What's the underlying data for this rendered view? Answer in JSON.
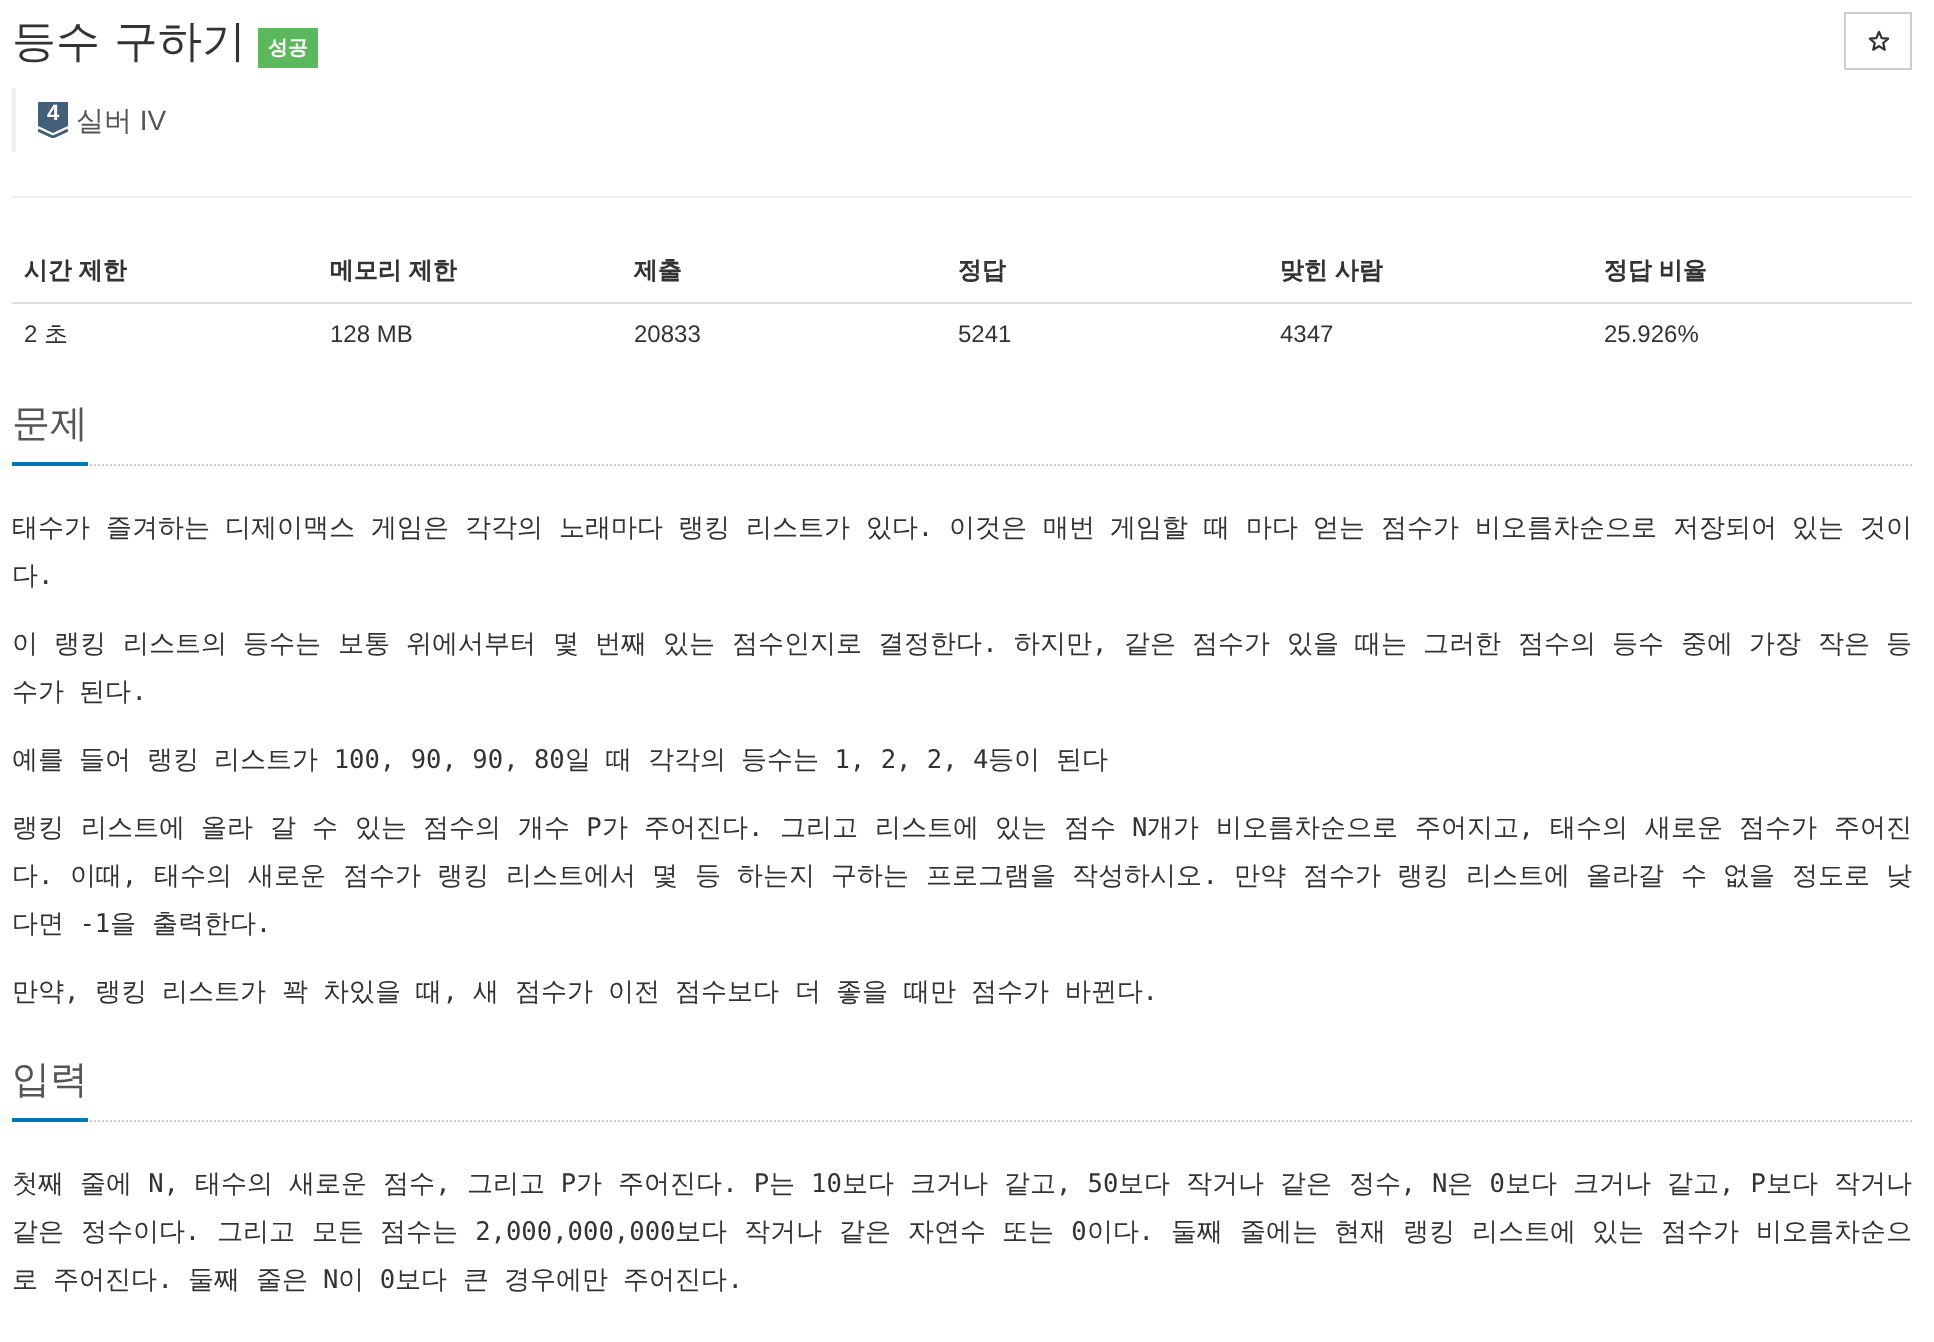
{
  "problem": {
    "title": "등수 구하기",
    "result_badge": {
      "label": "성공",
      "kind": "success"
    }
  },
  "tier": {
    "number": "4",
    "label": "실버 IV",
    "kind": "silver"
  },
  "stats": {
    "columns": [
      "시간 제한",
      "메모리 제한",
      "제출",
      "정답",
      "맞힌 사람",
      "정답 비율"
    ],
    "rows": [
      [
        "2 초",
        "128 MB",
        "20833",
        "5241",
        "4347",
        "25.926%"
      ]
    ]
  },
  "sections": [
    {
      "heading": "문제",
      "paragraphs": [
        "태수가 즐겨하는 디제이맥스 게임은 각각의 노래마다 랭킹 리스트가 있다. 이것은 매번 게임할 때 마다 얻는 점수가 비오름차순으로 저장되어 있는 것이다.",
        "이 랭킹 리스트의 등수는 보통 위에서부터 몇 번째 있는 점수인지로 결정한다. 하지만, 같은 점수가 있을 때는 그러한 점수의 등수 중에 가장 작은 등수가 된다.",
        "예를 들어 랭킹 리스트가 100, 90, 90, 80일 때 각각의 등수는 1, 2, 2, 4등이 된다",
        "랭킹 리스트에 올라 갈 수 있는 점수의 개수 P가 주어진다. 그리고 리스트에 있는 점수 N개가 비오름차순으로 주어지고, 태수의 새로운 점수가 주어진다. 이때, 태수의 새로운 점수가 랭킹 리스트에서 몇 등 하는지 구하는 프로그램을 작성하시오. 만약 점수가 랭킹 리스트에 올라갈 수 없을 정도로 낮다면 -1을 출력한다.",
        "만약, 랭킹 리스트가 꽉 차있을 때, 새 점수가 이전 점수보다 더 좋을 때만 점수가 바뀐다."
      ]
    },
    {
      "heading": "입력",
      "paragraphs": [
        "첫째 줄에 N, 태수의 새로운 점수, 그리고 P가 주어진다. P는 10보다 크거나 같고, 50보다 작거나 같은 정수, N은 0보다 크거나 같고, P보다 작거나 같은 정수이다. 그리고 모든 점수는 2,000,000,000보다 작거나 같은 자연수 또는 0이다. 둘째 줄에는 현재 랭킹 리스트에 있는 점수가 비오름차순으로 주어진다. 둘째 줄은 N이 0보다 큰 경우에만 주어진다."
      ]
    }
  ]
}
